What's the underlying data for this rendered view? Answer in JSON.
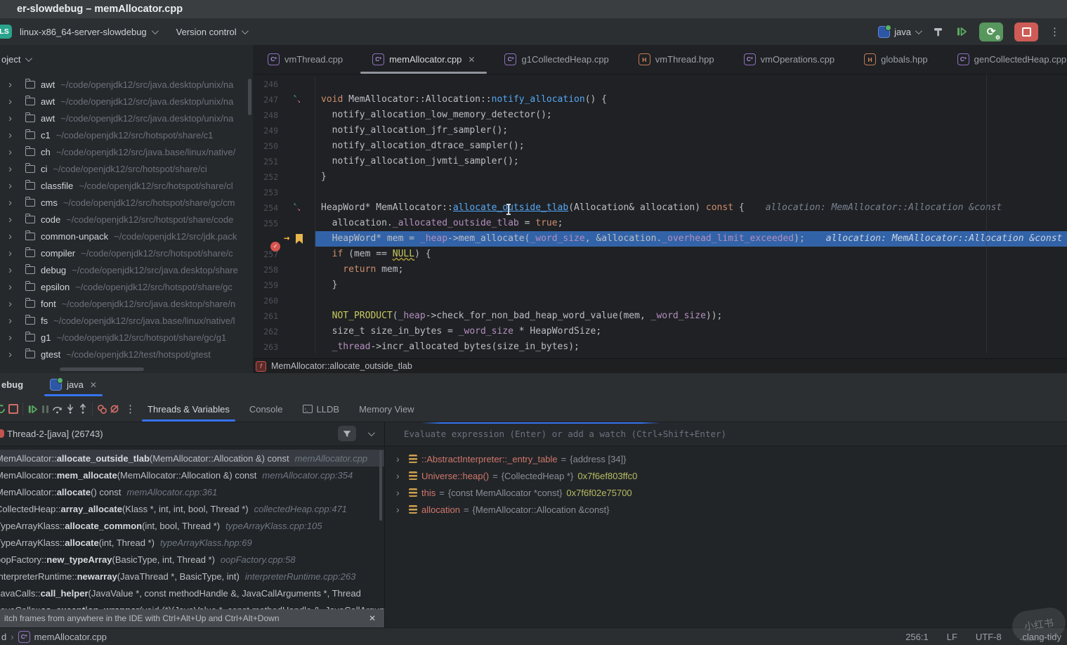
{
  "colors": {
    "accent": "#3574f0",
    "exec": "#3263a8",
    "bp": "#d75450",
    "bookmark": "#e8b64c",
    "run-green": "#5cab61",
    "stop-red": "#cf5b56",
    "rerun-bg": "#57965c"
  },
  "title_bar": {
    "title": "er-slowdebug – memAllocator.cpp"
  },
  "toolbar": {
    "config_badge": "LS",
    "run_config": "linux-x86_64-server-slowdebug",
    "version_control": "Version control",
    "session_label": "java",
    "icons": [
      "build-hammer",
      "debugger-resume",
      "rerun",
      "stop",
      "more-vertical"
    ]
  },
  "project": {
    "header": "oject",
    "items": [
      {
        "name": "awt",
        "path": "~/code/openjdk12/src/java.desktop/unix/na"
      },
      {
        "name": "awt",
        "path": "~/code/openjdk12/src/java.desktop/unix/na"
      },
      {
        "name": "awt",
        "path": "~/code/openjdk12/src/java.desktop/unix/na"
      },
      {
        "name": "c1",
        "path": "~/code/openjdk12/src/hotspot/share/c1"
      },
      {
        "name": "ch",
        "path": "~/code/openjdk12/src/java.base/linux/native/"
      },
      {
        "name": "ci",
        "path": "~/code/openjdk12/src/hotspot/share/ci"
      },
      {
        "name": "classfile",
        "path": "~/code/openjdk12/src/hotspot/share/cl"
      },
      {
        "name": "cms",
        "path": "~/code/openjdk12/src/hotspot/share/gc/cm"
      },
      {
        "name": "code",
        "path": "~/code/openjdk12/src/hotspot/share/code"
      },
      {
        "name": "common-unpack",
        "path": "~/code/openjdk12/src/jdk.pack"
      },
      {
        "name": "compiler",
        "path": "~/code/openjdk12/src/hotspot/share/c"
      },
      {
        "name": "debug",
        "path": "~/code/openjdk12/src/java.desktop/share"
      },
      {
        "name": "epsilon",
        "path": "~/code/openjdk12/src/hotspot/share/gc"
      },
      {
        "name": "font",
        "path": "~/code/openjdk12/src/java.desktop/share/n"
      },
      {
        "name": "fs",
        "path": "~/code/openjdk12/src/java.base/linux/native/l"
      },
      {
        "name": "g1",
        "path": "~/code/openjdk12/src/hotspot/share/gc/g1"
      },
      {
        "name": "gtest",
        "path": "~/code/openjdk12/test/hotspot/gtest"
      }
    ]
  },
  "editor": {
    "tabs": [
      {
        "label": "vmThread.cpp",
        "type": "cpp",
        "active": false,
        "closable": false
      },
      {
        "label": "memAllocator.cpp",
        "type": "cpp",
        "active": true,
        "closable": true
      },
      {
        "label": "g1CollectedHeap.cpp",
        "type": "cpp",
        "active": false,
        "closable": false
      },
      {
        "label": "vmThread.hpp",
        "type": "hpp",
        "active": false,
        "closable": false
      },
      {
        "label": "vmOperations.cpp",
        "type": "cpp",
        "active": false,
        "closable": false
      },
      {
        "label": "globals.hpp",
        "type": "hpp",
        "active": false,
        "closable": false
      },
      {
        "label": "genCollectedHeap.cpp",
        "type": "cpp",
        "active": false,
        "closable": false
      }
    ],
    "context_function": "MemAllocator::allocate_outside_tlab",
    "lines": [
      {
        "n": "246",
        "t": []
      },
      {
        "n": "247",
        "g": "arrows",
        "t": [
          [
            "k",
            "void"
          ],
          [
            "p",
            " MemAllocator::Allocation::"
          ],
          [
            "fn",
            "notify_allocation"
          ],
          [
            "p",
            "() {"
          ]
        ]
      },
      {
        "n": "248",
        "t": [
          [
            "p",
            "  notify_allocation_low_memory_detector();"
          ]
        ]
      },
      {
        "n": "249",
        "t": [
          [
            "p",
            "  notify_allocation_jfr_sampler();"
          ]
        ]
      },
      {
        "n": "250",
        "t": [
          [
            "p",
            "  notify_allocation_dtrace_sampler();"
          ]
        ]
      },
      {
        "n": "251",
        "t": [
          [
            "p",
            "  notify_allocation_jvmti_sampler();"
          ]
        ]
      },
      {
        "n": "252",
        "t": [
          [
            "p",
            "}"
          ]
        ]
      },
      {
        "n": "253",
        "t": []
      },
      {
        "n": "254",
        "g": "arrows",
        "t": [
          [
            "p",
            "HeapWord* MemAllocator::"
          ],
          [
            "fnu",
            "allocate_outside_tlab"
          ],
          [
            "p",
            "(Allocation& allocation) "
          ],
          [
            "k",
            "const"
          ],
          [
            "p",
            " {"
          ]
        ],
        "hint": "allocation: MemAllocator::Allocation &const"
      },
      {
        "n": "255",
        "t": [
          [
            "p",
            "  allocation."
          ],
          [
            "f",
            "_allocated_outside_tlab"
          ],
          [
            "p",
            " = "
          ],
          [
            "k",
            "true"
          ],
          [
            "p",
            ";"
          ]
        ]
      },
      {
        "n": "256",
        "g": "bp",
        "hl": true,
        "t": [
          [
            "p",
            "  HeapWord* mem = "
          ],
          [
            "f",
            "_heap"
          ],
          [
            "p",
            "->mem_allocate("
          ],
          [
            "f",
            "_word_size"
          ],
          [
            "p",
            ", &allocation."
          ],
          [
            "f",
            "_overhead_limit_exceeded"
          ],
          [
            "p",
            ");"
          ]
        ],
        "hint": "allocation: MemAllocator::Allocation &const"
      },
      {
        "n": "257",
        "t": [
          [
            "k",
            "  if"
          ],
          [
            "p",
            " (mem == "
          ],
          [
            "nul",
            "NULL"
          ],
          [
            "p",
            ") {"
          ]
        ]
      },
      {
        "n": "258",
        "t": [
          [
            "k",
            "    return"
          ],
          [
            "p",
            " mem;"
          ]
        ]
      },
      {
        "n": "259",
        "t": [
          [
            "p",
            "  }"
          ]
        ]
      },
      {
        "n": "260",
        "t": []
      },
      {
        "n": "261",
        "t": [
          [
            "m",
            "  NOT_PRODUCT"
          ],
          [
            "p",
            "("
          ],
          [
            "f",
            "_heap"
          ],
          [
            "p",
            "->check_for_non_bad_heap_word_value(mem, "
          ],
          [
            "f",
            "_word_size"
          ],
          [
            "p",
            "));"
          ]
        ]
      },
      {
        "n": "262",
        "t": [
          [
            "p",
            "  size_t size_in_bytes = "
          ],
          [
            "f",
            "_word_size"
          ],
          [
            "p",
            " * HeapWordSize;"
          ]
        ]
      },
      {
        "n": "263",
        "t": [
          [
            "f",
            "  _thread"
          ],
          [
            "p",
            "->incr_allocated_bytes(size_in_bytes);"
          ]
        ]
      }
    ]
  },
  "debug": {
    "window_label": "ebug",
    "session_tab": "java",
    "toolbar_icons": [
      "rerun",
      "stop",
      "resume",
      "pause",
      "step-over",
      "step-into",
      "step-out",
      "view-breakpoints",
      "mute-breakpoints",
      "more-vertical"
    ],
    "tabs": [
      {
        "label": "Threads & Variables",
        "active": true,
        "icon": null
      },
      {
        "label": "Console",
        "active": false,
        "icon": null
      },
      {
        "label": "LLDB",
        "active": false,
        "icon": "terminal"
      },
      {
        "label": "Memory View",
        "active": false,
        "icon": null
      }
    ],
    "thread": "Thread-2-[java] (26743)",
    "frames": [
      {
        "q": "MemAllocator::",
        "m": "allocate_outside_tlab",
        "par": "(MemAllocator::Allocation &) const",
        "file": "memAllocator.cpp",
        "sel": true
      },
      {
        "q": "MemAllocator::",
        "m": "mem_allocate",
        "par": "(MemAllocator::Allocation &) const",
        "file": "memAllocator.cpp:354",
        "sel": false
      },
      {
        "q": "MemAllocator::",
        "m": "allocate",
        "par": "() const",
        "file": "memAllocator.cpp:361",
        "sel": false
      },
      {
        "q": "CollectedHeap::",
        "m": "array_allocate",
        "par": "(Klass *, int, int, bool, Thread *)",
        "file": "collectedHeap.cpp:471",
        "sel": false
      },
      {
        "q": "TypeArrayKlass::",
        "m": "allocate_common",
        "par": "(int, bool, Thread *)",
        "file": "typeArrayKlass.cpp:105",
        "sel": false
      },
      {
        "q": "TypeArrayKlass::",
        "m": "allocate",
        "par": "(int, Thread *)",
        "file": "typeArrayKlass.hpp:69",
        "sel": false
      },
      {
        "q": "oopFactory::",
        "m": "new_typeArray",
        "par": "(BasicType, int, Thread *)",
        "file": "oopFactory.cpp:58",
        "sel": false
      },
      {
        "q": "InterpreterRuntime::",
        "m": "newarray",
        "par": "(JavaThread *, BasicType, int)",
        "file": "interpreterRuntime.cpp:263",
        "sel": false
      },
      {
        "q": "JavaCalls::",
        "m": "call_helper",
        "par": "(JavaValue *, const methodHandle &, JavaCallArguments *, Thread",
        "file": "",
        "sel": false
      },
      {
        "q": "JavaCalls::",
        "m": "os_exception_wrapper",
        "par": "(void (*)(JavaValue *, const methodHandle &, JavaCallArgume",
        "file": "",
        "sel": false
      }
    ],
    "hint_banner": "itch frames from anywhere in the IDE with Ctrl+Alt+Up and Ctrl+Alt+Down",
    "evaluate_placeholder": "Evaluate expression (Enter) or add a watch (Ctrl+Shift+Enter)",
    "variables": [
      {
        "name": "::AbstractInterpreter::_entry_table",
        "type": "{address [34]}",
        "addr": ""
      },
      {
        "name": "Universe::heap()",
        "type": "{CollectedHeap *}",
        "addr": "0x7f6ef803ffc0"
      },
      {
        "name": "this",
        "type": "{const MemAllocator *const}",
        "addr": "0x7f6f02e75700"
      },
      {
        "name": "allocation",
        "type": "{MemAllocator::Allocation &const}",
        "addr": ""
      }
    ]
  },
  "status_bar": {
    "crumb_prefix": "d",
    "file": "memAllocator.cpp",
    "right_items": [
      "256:1",
      "LF",
      "UTF-8",
      ".clang-tidy"
    ]
  },
  "watermark": {
    "text": "小红书"
  }
}
